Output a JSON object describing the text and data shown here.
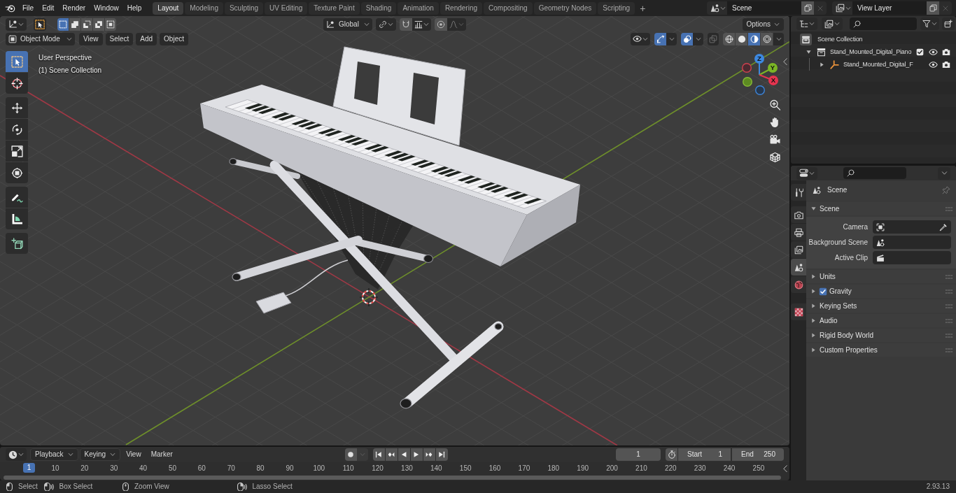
{
  "top_bar": {
    "menus": [
      "File",
      "Edit",
      "Render",
      "Window",
      "Help"
    ],
    "workspaces": [
      {
        "label": "Layout",
        "selected": true
      },
      {
        "label": "Modeling",
        "selected": false
      },
      {
        "label": "Sculpting",
        "selected": false
      },
      {
        "label": "UV Editing",
        "selected": false
      },
      {
        "label": "Texture Paint",
        "selected": false
      },
      {
        "label": "Shading",
        "selected": false
      },
      {
        "label": "Animation",
        "selected": false
      },
      {
        "label": "Rendering",
        "selected": false
      },
      {
        "label": "Compositing",
        "selected": false
      },
      {
        "label": "Geometry Nodes",
        "selected": false
      },
      {
        "label": "Scripting",
        "selected": false
      }
    ],
    "add_workspace": "+",
    "scene": "Scene",
    "view_layer": "View Layer"
  },
  "viewport": {
    "tool_header": {
      "selection_modes": [
        {
          "kind": "new",
          "selected": true
        },
        {
          "kind": "extend",
          "selected": false
        },
        {
          "kind": "subtract",
          "selected": false
        },
        {
          "kind": "invert",
          "selected": false
        },
        {
          "kind": "intersect",
          "selected": false
        }
      ],
      "orientation": "Global",
      "options": "Options"
    },
    "header": {
      "mode": "Object Mode",
      "menus": [
        "View",
        "Select",
        "Add",
        "Object"
      ],
      "show_gizmos": true,
      "show_overlays": true,
      "shading": [
        {
          "kind": "wireframe",
          "selected": false
        },
        {
          "kind": "solid",
          "selected": false
        },
        {
          "kind": "material",
          "selected": true
        },
        {
          "kind": "rendered",
          "selected": false
        }
      ]
    },
    "tool_groups": [
      {
        "tools": [
          {
            "kind": "select_box",
            "selected": true
          },
          {
            "kind": "cursor",
            "selected": false
          }
        ]
      },
      {
        "tools": [
          {
            "kind": "move",
            "selected": false
          },
          {
            "kind": "rotate",
            "selected": false
          },
          {
            "kind": "scale",
            "selected": false
          },
          {
            "kind": "transform",
            "selected": false
          }
        ]
      },
      {
        "tools": [
          {
            "kind": "annotate",
            "selected": false
          },
          {
            "kind": "measure",
            "selected": false
          }
        ]
      },
      {
        "tools": [
          {
            "kind": "add_cube",
            "selected": false
          }
        ]
      }
    ],
    "info": [
      "User Perspective",
      "(1) Scene Collection"
    ],
    "gizmo_axes": [
      {
        "label": "Z",
        "color": "#3d88e0"
      },
      {
        "label": "Y",
        "color": "#7bb625"
      },
      {
        "label": "X",
        "color": "#e5344f"
      }
    ],
    "navigation": [
      {
        "kind": "zoom"
      },
      {
        "kind": "pan"
      },
      {
        "kind": "camera"
      },
      {
        "kind": "ortho"
      }
    ]
  },
  "outliner": {
    "tree": [
      {
        "label": "Scene Collection",
        "kind": "scene_collection",
        "children": [
          {
            "label": "Stand_Mounted_Digital_Piano",
            "kind": "collection",
            "expanded": true,
            "checked": true,
            "children": [
              {
                "label": "Stand_Mounted_Digital_F",
                "kind": "empty",
                "expanded": false
              }
            ]
          }
        ]
      }
    ]
  },
  "properties": {
    "tab_groups": [
      {
        "tabs": [
          {
            "kind": "tool",
            "selected": false
          }
        ]
      },
      {
        "tabs": [
          {
            "kind": "render",
            "selected": false
          },
          {
            "kind": "output",
            "selected": false
          },
          {
            "kind": "view_layer",
            "selected": false
          },
          {
            "kind": "scene",
            "selected": true
          },
          {
            "kind": "world",
            "selected": false
          }
        ]
      },
      {
        "tabs": [
          {
            "kind": "texture",
            "selected": false
          }
        ]
      }
    ],
    "context": "Scene",
    "panels": [
      {
        "label": "Scene",
        "expanded": true,
        "fields": [
          {
            "label": "Camera",
            "kind": "camera"
          },
          {
            "label": "Background Scene",
            "kind": "scene"
          },
          {
            "label": "Active Clip",
            "kind": "clip"
          }
        ]
      },
      {
        "label": "Units",
        "expanded": false
      },
      {
        "label": "Gravity",
        "expanded": false,
        "checked": true
      },
      {
        "label": "Keying Sets",
        "expanded": false
      },
      {
        "label": "Audio",
        "expanded": false
      },
      {
        "label": "Rigid Body World",
        "expanded": false
      },
      {
        "label": "Custom Properties",
        "expanded": false
      }
    ]
  },
  "timeline": {
    "menus": [
      {
        "label": "Playback",
        "kind": "dropdown"
      },
      {
        "label": "Keying",
        "kind": "dropdown"
      },
      {
        "label": "View",
        "kind": "menu"
      },
      {
        "label": "Marker",
        "kind": "menu"
      }
    ],
    "current_frame": "1",
    "start_label": "Start",
    "start": "1",
    "end_label": "End",
    "end": "250",
    "playhead": "1",
    "ruler": [
      "10",
      "20",
      "30",
      "40",
      "50",
      "60",
      "70",
      "80",
      "90",
      "100",
      "110",
      "120",
      "130",
      "140",
      "150",
      "160",
      "170",
      "180",
      "190",
      "200",
      "210",
      "220",
      "230",
      "240",
      "250"
    ]
  },
  "status_bar": {
    "hints": [
      {
        "label": "Select",
        "kind": "left_click"
      },
      {
        "label": "Box Select",
        "kind": "left_drag"
      },
      {
        "label": "Zoom View",
        "kind": "middle"
      },
      {
        "label": "Lasso Select",
        "kind": "right_drag"
      }
    ],
    "version": "2.93.13"
  }
}
